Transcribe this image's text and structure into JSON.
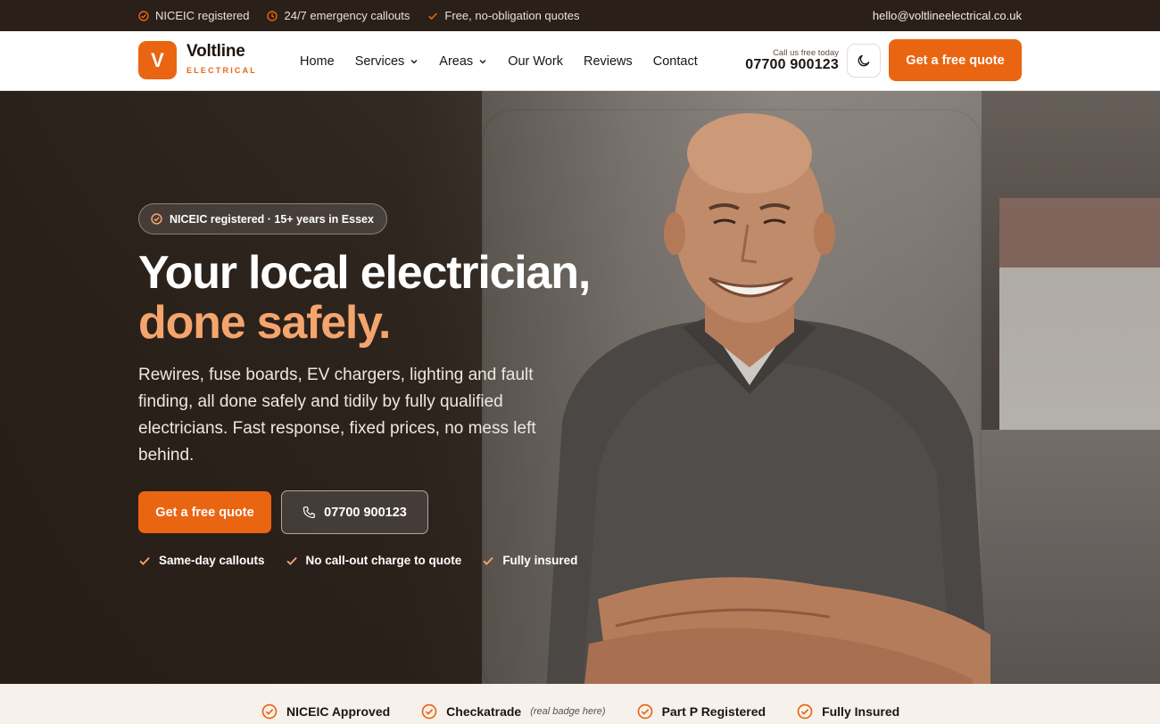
{
  "topbar": {
    "items": [
      "NICEIC registered",
      "24/7 emergency callouts",
      "Free, no-obligation quotes"
    ],
    "email": "hello@voltlineelectrical.co.uk"
  },
  "header": {
    "logo_letter": "V",
    "brand": "Voltline",
    "brand_sub": "ELECTRICAL",
    "nav": [
      "Home",
      "Services",
      "Areas",
      "Our Work",
      "Reviews",
      "Contact"
    ],
    "call_label": "Call us free today",
    "phone": "07700 900123",
    "cta": "Get a free quote"
  },
  "hero": {
    "badge": "NICEIC registered · 15+ years in Essex",
    "title_line1": "Your local electrician,",
    "title_line2": "done safely.",
    "lead": "Rewires, fuse boards, EV chargers, lighting and fault finding, all done safely and tidily by fully qualified electricians. Fast response, fixed prices, no mess left behind.",
    "cta_primary": "Get a free quote",
    "cta_phone": "07700 900123",
    "checks": [
      "Same-day callouts",
      "No call-out charge to quote",
      "Fully insured"
    ]
  },
  "trust": {
    "items": [
      "NICEIC Approved",
      "Checkatrade",
      "Part P Registered",
      "Fully Insured"
    ],
    "checkatrade_note": "(real badge here)"
  },
  "colors": {
    "accent": "#ea6512",
    "accent_light": "#f4a56d",
    "topbar_bg": "#2a1f19",
    "trust_bg": "#f7f1ec"
  }
}
